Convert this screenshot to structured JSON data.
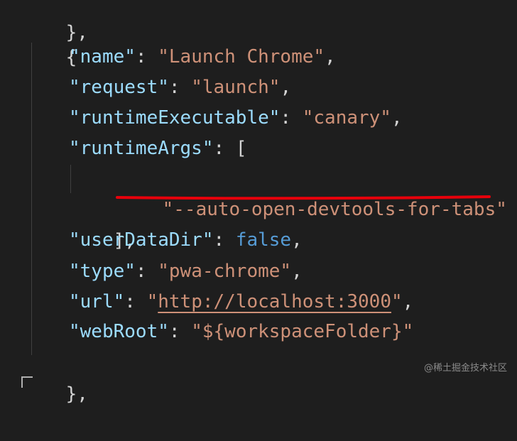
{
  "code": {
    "top_close": "},",
    "open_brace": "{",
    "name": {
      "key": "\"name\"",
      "value": "\"Launch Chrome\""
    },
    "request": {
      "key": "\"request\"",
      "value": "\"launch\""
    },
    "runtimeExecutable": {
      "key": "\"runtimeExecutable\"",
      "value": "\"canary\""
    },
    "runtimeArgs": {
      "key": "\"runtimeArgs\"",
      "open": "["
    },
    "arg": "\"--auto-open-devtools-for-tabs\"",
    "args_close": "],",
    "userDataDir": {
      "key": "\"userDataDir\"",
      "value": "false"
    },
    "type": {
      "key": "\"type\"",
      "value": "\"pwa-chrome\""
    },
    "url": {
      "key": "\"url\"",
      "quote_open": "\"",
      "value": "http://localhost:3000",
      "quote_close": "\""
    },
    "webRoot": {
      "key": "\"webRoot\"",
      "value": "\"${workspaceFolder}\""
    },
    "close_brace": "},"
  },
  "watermark": "@稀土掘金技术社区",
  "colors": {
    "background": "#1e1e1e",
    "key": "#9cdcfe",
    "string": "#ce9178",
    "keyword": "#569cd6",
    "punctuation": "#d4d4d4",
    "annotation": "#e8000b"
  }
}
